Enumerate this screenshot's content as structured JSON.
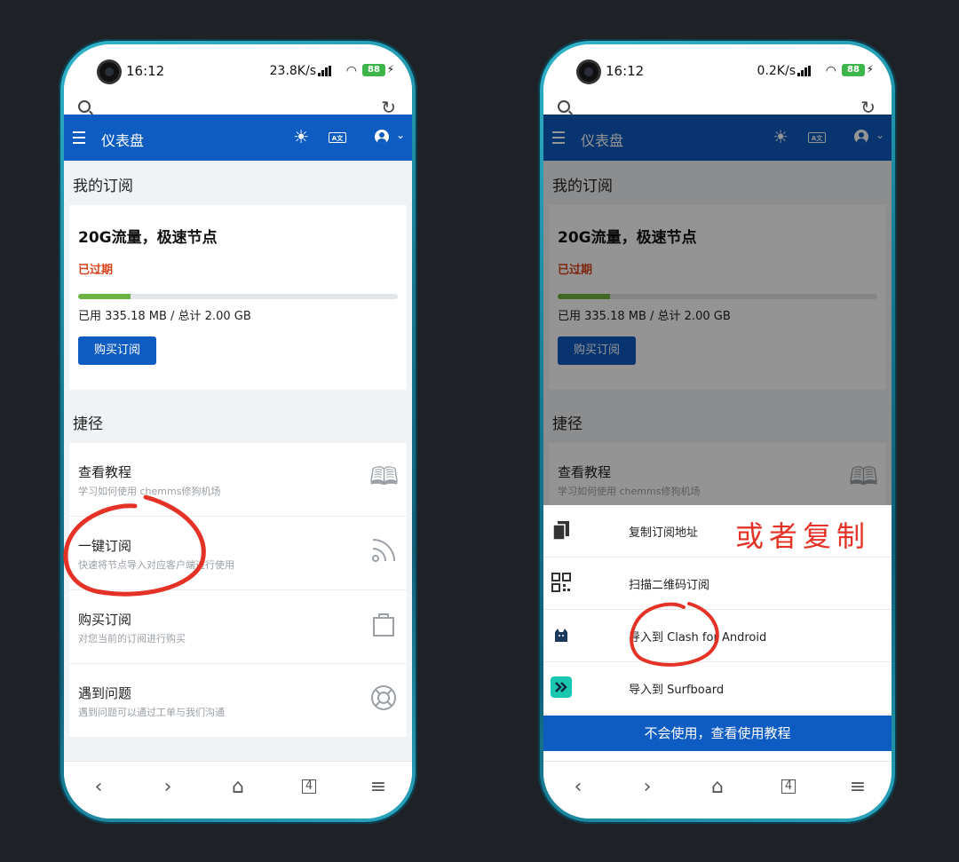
{
  "left": {
    "status": {
      "time": "16:12",
      "speed": "23.8K/s",
      "battery": "88"
    },
    "header": {
      "title": "仪表盘"
    },
    "subscription": {
      "section_title": "我的订阅",
      "plan_name": "20G流量，极速节点",
      "status": "已过期",
      "usage_text": "已用 335.18 MB / 总计 2.00 GB",
      "usage_fraction": 0.164,
      "buy_label": "购买订阅"
    },
    "shortcuts": {
      "section_title": "捷径",
      "items": [
        {
          "title": "查看教程",
          "desc": "学习如何使用 chemms修狗机场",
          "icon": "book-icon"
        },
        {
          "title": "一键订阅",
          "desc": "快速将节点导入对应客户端进行使用",
          "icon": "rss-icon"
        },
        {
          "title": "购买订阅",
          "desc": "对您当前的订阅进行购买",
          "icon": "bag-icon"
        },
        {
          "title": "遇到问题",
          "desc": "遇到问题可以通过工单与我们沟通",
          "icon": "lifebuoy-icon"
        }
      ]
    },
    "nav": {
      "tabs_count": "4"
    },
    "annotation_color": "#e53226"
  },
  "right": {
    "status": {
      "time": "16:12",
      "speed": "0.2K/s",
      "battery": "88"
    },
    "header": {
      "title": "仪表盘"
    },
    "subscription": {
      "section_title": "我的订阅",
      "plan_name": "20G流量，极速节点",
      "status": "已过期",
      "usage_text": "已用 335.18 MB / 总计 2.00 GB",
      "usage_fraction": 0.164,
      "buy_label": "购买订阅"
    },
    "shortcuts": {
      "section_title": "捷径",
      "items": [
        {
          "title": "查看教程",
          "desc": "学习如何使用 chemms修狗机场",
          "icon": "book-icon"
        }
      ]
    },
    "sheet": {
      "items": [
        {
          "label": "复制订阅地址",
          "icon": "copy-icon"
        },
        {
          "label": "扫描二维码订阅",
          "icon": "qr-icon"
        },
        {
          "label": "导入到 Clash for Android",
          "icon": "clash-cat-icon"
        },
        {
          "label": "导入到 Surfboard",
          "icon": "surfboard-icon"
        }
      ],
      "tutorial_button": "不会使用，查看使用教程"
    },
    "annotation_text": "或者复制",
    "nav": {
      "tabs_count": "4"
    }
  },
  "colors": {
    "brand": "#0e5cc2",
    "expired": "#d9421c",
    "progress": "#6cb33f",
    "frame": "#167a92"
  }
}
